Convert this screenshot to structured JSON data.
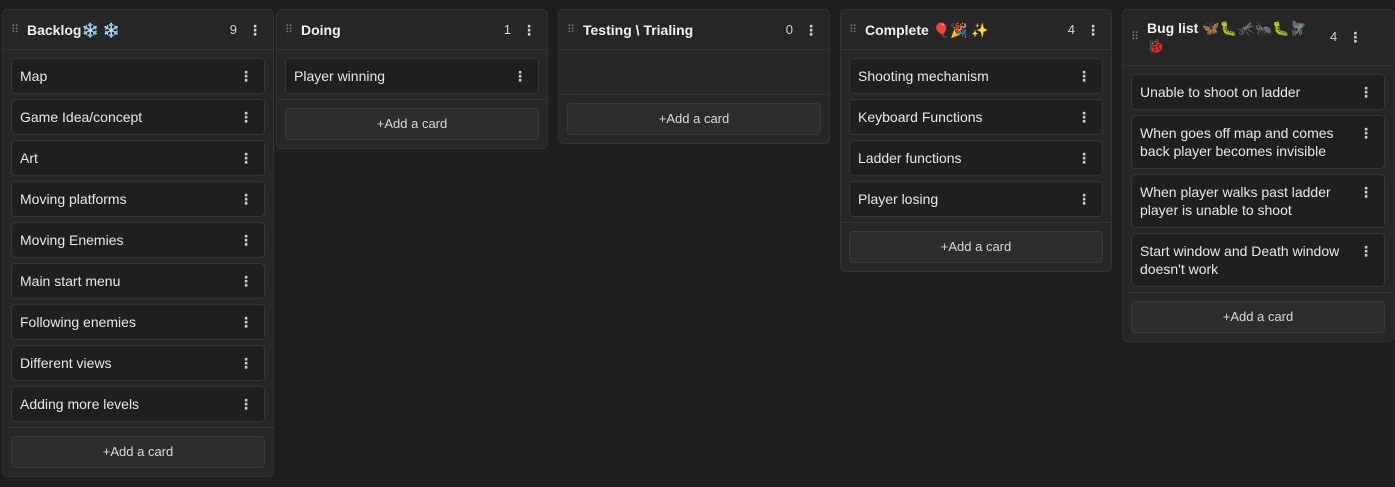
{
  "columns": [
    {
      "title": "Backlog❄️ ❄️",
      "count": "9",
      "cards": [
        "Map",
        "Game Idea/concept",
        "Art",
        "Moving platforms",
        "Moving Enemies",
        "Main start menu",
        "Following enemies",
        "Different views",
        "Adding more levels"
      ],
      "add_label": "+Add a card"
    },
    {
      "title": "Doing",
      "count": "1",
      "cards": [
        "Player winning"
      ],
      "add_label": "+Add a card"
    },
    {
      "title": "Testing \\ Trialing",
      "count": "0",
      "cards": [],
      "add_label": "+Add a card"
    },
    {
      "title": "Complete 🎈🎉 ✨",
      "count": "4",
      "cards": [
        "Shooting mechanism",
        "Keyboard Functions",
        "Ladder functions",
        "Player losing"
      ],
      "add_label": "+Add a card"
    },
    {
      "title": "Bug list 🦋🐛🦟🐜🐛🪰 🐞",
      "count": "4",
      "cards": [
        "Unable to shoot on ladder",
        "When goes off map and comes back player becomes invisible",
        "When player walks past ladder player is unable to shoot",
        "Start window and Death window doesn't work"
      ],
      "add_label": "+Add a card"
    }
  ],
  "icons": {
    "drag": "drag-handle-icon",
    "menu": "more-vertical-icon"
  },
  "colors": {
    "background": "#1e1e1e",
    "column": "#262626",
    "card": "#1f1f1f",
    "border": "#333333"
  }
}
